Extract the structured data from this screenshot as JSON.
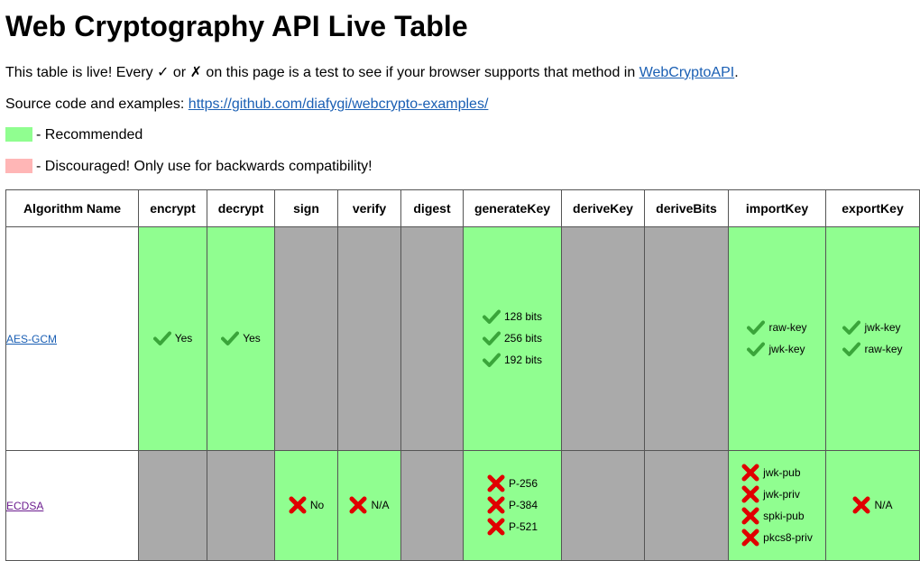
{
  "title": "Web Cryptography API Live Table",
  "intro": {
    "text": "This table is live! Every ✓ or ✗ on this page is a test to see if your browser supports that method in ",
    "link": "WebCryptoAPI",
    "end": "."
  },
  "source": {
    "label": "Source code and examples: ",
    "link": "https://github.com/diafygi/webcrypto-examples/"
  },
  "legend": {
    "recommended": "- Recommended",
    "discouraged": "- Discouraged! Only use for backwards compatibility!",
    "recommended_color": "#90fe90",
    "discouraged_color": "#ffb6b6"
  },
  "colors": {
    "supported": "#90fe90",
    "unsupported": "#aaaaaa",
    "check": "#3aa53a",
    "cross": "#e00000"
  },
  "table": {
    "headers": [
      "Algorithm Name",
      "encrypt",
      "decrypt",
      "sign",
      "verify",
      "digest",
      "generateKey",
      "deriveKey",
      "deriveBits",
      "importKey",
      "exportKey"
    ],
    "rows": [
      {
        "algorithm": "AES-GCM",
        "encrypt": "Yes",
        "decrypt": "Yes",
        "generateKey": [
          "128 bits",
          "256 bits",
          "192 bits"
        ],
        "importKey": [
          "raw-key",
          "jwk-key"
        ],
        "exportKey": [
          "jwk-key",
          "raw-key"
        ]
      },
      {
        "algorithm": "ECDSA",
        "sign": "No",
        "verify": "N/A",
        "generateKey": [
          "P-256",
          "P-384",
          "P-521"
        ],
        "importKey": [
          "jwk-pub",
          "jwk-priv",
          "spki-pub",
          "pkcs8-priv"
        ],
        "exportKey": [
          "N/A"
        ]
      }
    ]
  }
}
